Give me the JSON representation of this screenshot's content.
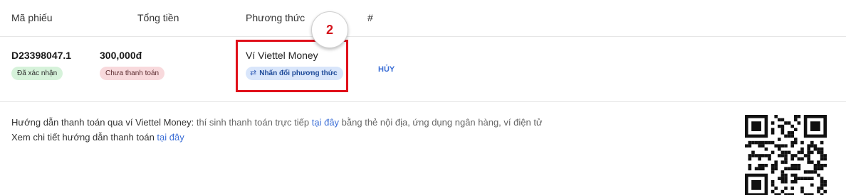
{
  "table": {
    "headers": {
      "code": "Mã phiếu",
      "total": "Tổng tiền",
      "method": "Phương thức",
      "hash": "#"
    },
    "row": {
      "code": "D23398047.1",
      "status": "Đã xác nhận",
      "amount": "300,000đ",
      "payment_status": "Chưa thanh toán",
      "method_name": "Ví Viettel Money",
      "change_method_label": "Nhấn đổi phương thức",
      "change_method_icon": "repeat-icon",
      "cancel_label": "HỦY"
    }
  },
  "annotation": {
    "step_number": "2",
    "highlight_color": "#e0101a"
  },
  "instructions": {
    "line1_title": "Hướng dẫn thanh toán qua ví Viettel Money:",
    "line1_text_a": " thí sinh thanh toán trực tiếp ",
    "line1_link": "tại đây",
    "line1_text_b": " bằng thẻ nội địa, ứng dụng ngân hàng, ví điện tử",
    "line2_text": "Xem chi tiết hướng dẫn thanh toán ",
    "line2_link": "tại đây"
  },
  "colors": {
    "link": "#3b6ed6",
    "confirmed_badge_bg": "#d6f2da",
    "unpaid_badge_bg": "#f8d9dc",
    "method_pill_bg": "#d9e6fb"
  }
}
